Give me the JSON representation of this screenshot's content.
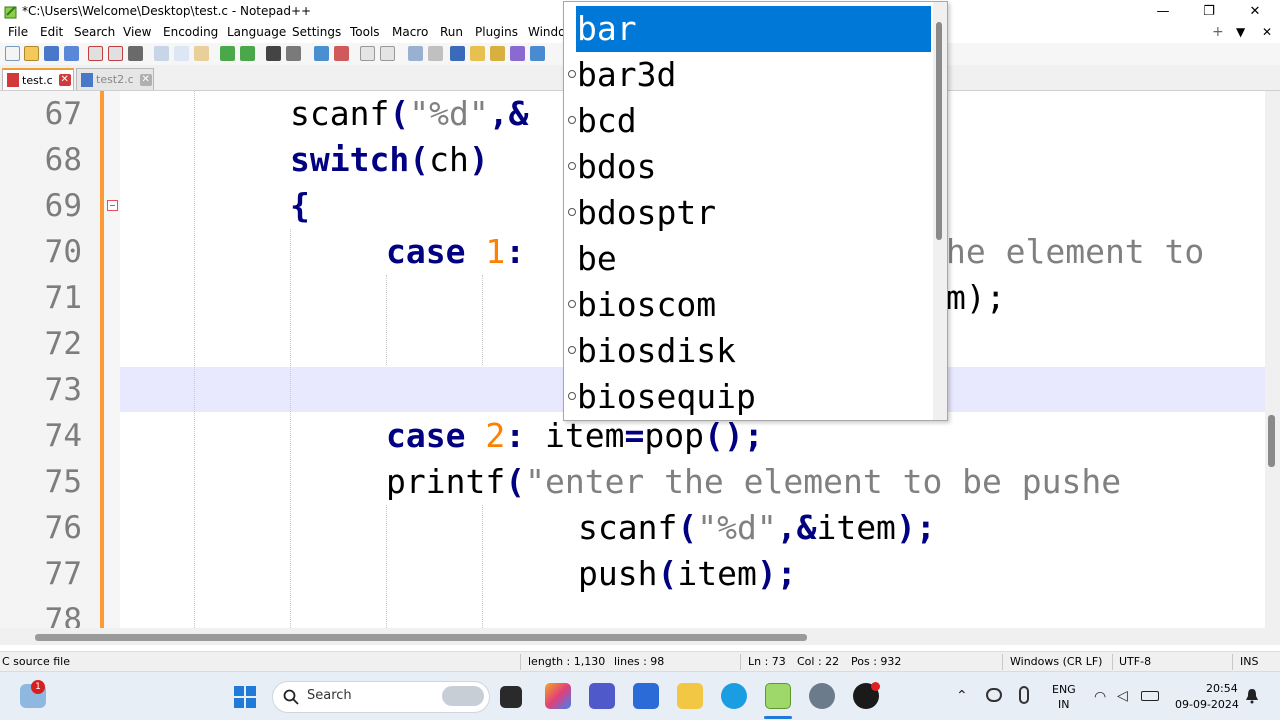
{
  "window": {
    "title": "*C:\\Users\\Welcome\\Desktop\\test.c - Notepad++",
    "controls": [
      "—",
      "❐",
      "✕"
    ]
  },
  "menu": [
    "File",
    "Edit",
    "Search",
    "View",
    "Encoding",
    "Language",
    "Settings",
    "Tools",
    "Macro",
    "Run",
    "Plugins",
    "Windo"
  ],
  "menu_right": {
    "plus": "+",
    "dropdown": "▼",
    "close": "✕"
  },
  "tabs": [
    {
      "label": "test.c",
      "active": true,
      "modified": true,
      "close": "✕"
    },
    {
      "label": "test2.c",
      "active": false,
      "modified": false,
      "close": "✕"
    }
  ],
  "editor": {
    "lines": [
      {
        "num": "67",
        "text": "scanf(\"%d\",&"
      },
      {
        "num": "68",
        "text": "switch(ch)"
      },
      {
        "num": "69",
        "text": "{"
      },
      {
        "num": "70",
        "text": "case 1:",
        "tail": "he element to"
      },
      {
        "num": "71",
        "text": "",
        "tail": "m);"
      },
      {
        "num": "72",
        "text": ""
      },
      {
        "num": "73",
        "text": ""
      },
      {
        "num": "74",
        "text": "case 2: item=pop();"
      },
      {
        "num": "75",
        "text": "printf(\"enter the element to be pushe"
      },
      {
        "num": "76",
        "text": "scanf(\"%d\",&item);"
      },
      {
        "num": "77",
        "text": "push(item);"
      },
      {
        "num": "78",
        "text": ""
      }
    ],
    "current_line": "73"
  },
  "autocomplete": {
    "items": [
      "bar",
      "bar3d",
      "bcd",
      "bdos",
      "bdosptr",
      "be",
      "bioscom",
      "biosdisk",
      "biosequip"
    ],
    "selected": "bar",
    "no_icon": [
      "be"
    ]
  },
  "statusbar": {
    "file_type": "C source file",
    "length": "length : 1,130",
    "lines": "lines : 98",
    "ln": "Ln : 73",
    "col": "Col : 22",
    "pos": "Pos : 932",
    "eol": "Windows (CR LF)",
    "encoding": "UTF-8",
    "mode": "INS"
  },
  "taskbar": {
    "search_label": "Search",
    "notification_badge": "1",
    "lang_top": "ENG",
    "lang_bottom": "IN",
    "time": "20:54",
    "date": "09-09-2024"
  },
  "colors": {
    "keyword": "#000080",
    "number": "#ff8000",
    "string": "#808080",
    "selection": "#0078d7",
    "current_line": "#e8e8ff",
    "change_bar": "#ff9933"
  }
}
